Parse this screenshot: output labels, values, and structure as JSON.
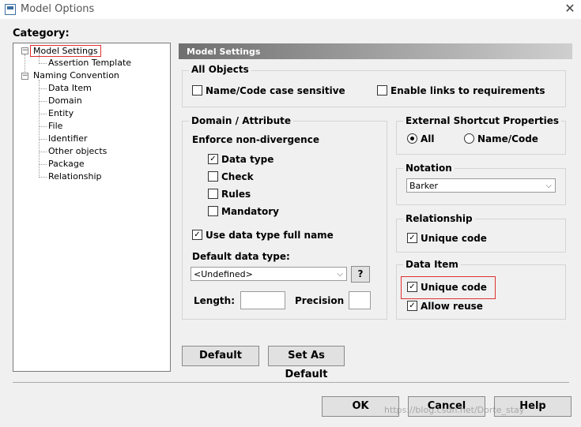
{
  "window": {
    "title": "Model Options",
    "close_icon": "close-icon"
  },
  "category": {
    "label": "Category:",
    "tree": [
      "Model Settings",
      "Assertion Template",
      "Naming Convention",
      "Data Item",
      "Domain",
      "Entity",
      "File",
      "Identifier",
      "Other objects",
      "Package",
      "Relationship"
    ]
  },
  "panel": {
    "title": "Model Settings",
    "all_objects": {
      "title": "All Objects",
      "case_sensitive": "Name/Code case sensitive",
      "enable_links": "Enable links to requirements"
    },
    "domain": {
      "title": "Domain / Attribute",
      "enforce": "Enforce non-divergence",
      "data_type": "Data type",
      "check": "Check",
      "rules": "Rules",
      "mandatory": "Mandatory",
      "full_name": "Use data type full name",
      "default_type_label": "Default data type:",
      "default_type_value": "<Undefined>",
      "help_btn": "?",
      "length_label": "Length:",
      "precision_label": "Precision"
    },
    "external": {
      "title": "External Shortcut Properties",
      "all": "All",
      "name_code": "Name/Code"
    },
    "notation": {
      "title": "Notation",
      "value": "Barker"
    },
    "relationship": {
      "title": "Relationship",
      "unique": "Unique code"
    },
    "data_item": {
      "title": "Data Item",
      "unique": "Unique code",
      "reuse": "Allow reuse"
    },
    "default_btn": "Default",
    "set_default_btn": "Set As Default"
  },
  "buttons": {
    "ok": "OK",
    "cancel": "Cancel",
    "help": "Help"
  },
  "checks": {
    "on": "✓"
  },
  "watermark": "https://blog.csdn.net/Dorte_stay",
  "colors": {
    "highlight": "#e03030"
  }
}
